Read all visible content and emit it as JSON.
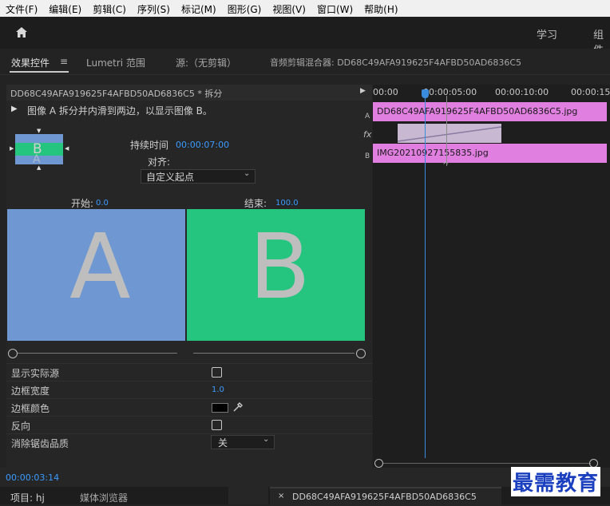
{
  "menubar": {
    "items": [
      "文件(F)",
      "编辑(E)",
      "剪辑(C)",
      "序列(S)",
      "标记(M)",
      "图形(G)",
      "视图(V)",
      "窗口(W)",
      "帮助(H)"
    ]
  },
  "header": {
    "workspace_tabs": [
      "学习",
      "组件"
    ]
  },
  "panel_tabs": {
    "effect_controls": "效果控件",
    "lumetri": "Lumetri 范围",
    "source": "源:（无剪辑）",
    "audio_mixer": "音频剪辑混合器: DD68C49AFA919625F4AFBD50AD6836C5"
  },
  "effect_controls": {
    "clip_title": "DD68C49AFA919625F4AFBD50AD6836C5 * 拆分",
    "description": "图像 A 拆分并内滑到两边，以显示图像 B。",
    "duration_label": "持续时间",
    "duration_value": "00:00:07:00",
    "align_label": "对齐:",
    "align_value": "自定义起点",
    "start_label": "开始:",
    "start_value": "0.0",
    "end_label": "结束:",
    "end_value": "100.0",
    "preview_a": "A",
    "preview_b": "B",
    "thumb_letter_b": "B",
    "thumb_letter_a": "A",
    "properties": [
      {
        "label": "显示实际源",
        "type": "checkbox"
      },
      {
        "label": "边框宽度",
        "value": "1.0"
      },
      {
        "label": "边框颜色",
        "type": "color"
      },
      {
        "label": "反向",
        "type": "checkbox"
      },
      {
        "label": "消除锯齿品质",
        "value": "关"
      }
    ],
    "timecode": "00:00:03:14"
  },
  "timeline": {
    "ruler": [
      "00:00",
      "00:00:05:00",
      "00:00:10:00",
      "00:00:15"
    ],
    "track_a_label": "A",
    "track_b_label": "B",
    "fx_label": "fx",
    "clip_a": "DD68C49AFA919625F4AFBD50AD6836C5.jpg",
    "clip_b": "IMG20210927155835.jpg"
  },
  "bottom": {
    "project_tab": "项目: hj",
    "media_browser_tab": "媒体浏览器",
    "sequence_tab": "DD68C49AFA919625F4AFBD50AD6836C5"
  },
  "watermark": "最需教育",
  "colors": {
    "accent_blue": "#3a9bff",
    "preview_a": "#6f98d2",
    "preview_b": "#25c47f",
    "clip_pink": "#e07fe0"
  }
}
